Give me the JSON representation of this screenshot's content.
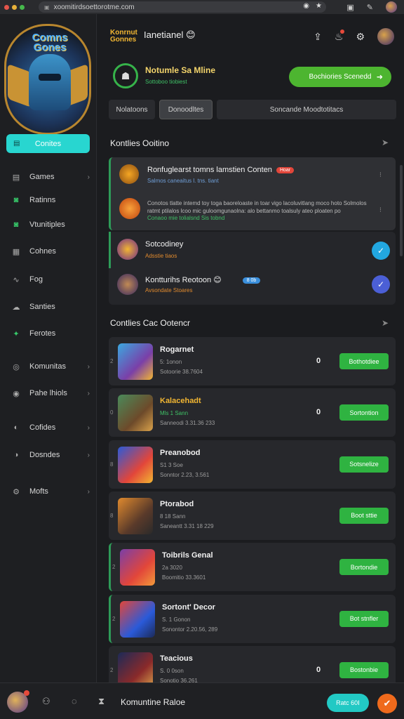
{
  "browser": {
    "url": "xoomitirdsoettorotme.com"
  },
  "sidebar": {
    "logo_text": "Comns Gones",
    "primary_button": "Conites",
    "items": [
      {
        "label": "Games",
        "icon": "gamepad-icon",
        "glyph": "▤",
        "chevron": true
      },
      {
        "label": "Ratinns",
        "icon": "discord-icon",
        "glyph": "◙",
        "chevron": false
      },
      {
        "label": "Vtunitiples",
        "icon": "discord-icon",
        "glyph": "◙",
        "chevron": false
      },
      {
        "label": "Cohnes",
        "icon": "grid-icon",
        "glyph": "▦",
        "chevron": false
      },
      {
        "label": "Fog",
        "icon": "chart-icon",
        "glyph": "∿",
        "chevron": false
      },
      {
        "label": "Santies",
        "icon": "cloud-icon",
        "glyph": "☁",
        "chevron": false
      },
      {
        "label": "Ferotes",
        "icon": "puzzle-icon",
        "glyph": "✦",
        "chevron": false
      },
      {
        "label": "Komunitas",
        "icon": "community-icon",
        "glyph": "◎",
        "chevron": true
      },
      {
        "label": "Pahe lhiols",
        "icon": "trophy-icon",
        "glyph": "◉",
        "chevron": true
      },
      {
        "label": "Cofides",
        "icon": "globe-icon",
        "glyph": "◐",
        "chevron": true
      },
      {
        "label": "Dosndes",
        "icon": "compass-icon",
        "glyph": "◑",
        "chevron": true
      },
      {
        "label": "Mofts",
        "icon": "gear-icon",
        "glyph": "⚙",
        "chevron": true
      }
    ]
  },
  "header": {
    "brand": "Konrnut Gonnes",
    "title": "Ianetianel 😊"
  },
  "profile": {
    "name": "Notumle Sa Mline",
    "subtitle": "Sottoboo tiobiest",
    "cta": "Bochiories Scenedd"
  },
  "tabs": [
    "Nolatoons",
    "Donoodltes",
    "Soncande Moodtotitacs"
  ],
  "notifications": {
    "title": "Kontlies Ooitino",
    "items": [
      {
        "title": "Ronfuglearst tomns lamstien Conten",
        "badge": "Hoar",
        "sub": "Salmos caneaitus l. tns. tiant",
        "sub_color": "#6f9ed6"
      },
      {
        "title": "",
        "body": "Conotos tlatte intemd toy toga baoreloaste in toar vigo lacoluvitlang moco hoto Solmolos ratmt ptilalos lcoo mic guloomgunaolna: alo bettanmo toalsuly ateo ploaten po gooptooodo ooonomoolo.",
        "sub": "Conaoo mie tolialsnd Sis tobnd",
        "sub_color": "#3fc166"
      },
      {
        "title": "Sotcodiney",
        "sub": "Adsstie tiaos",
        "sub_color": "#e08a2e"
      },
      {
        "title": "Kontturihs Reotoon 😊",
        "tag": "8 0b",
        "sub": "Avsondate Stoares",
        "sub_color": "#e08a2e"
      }
    ]
  },
  "games": {
    "title": "Contlies Cac Ootencr",
    "items": [
      {
        "rank": "2",
        "name": "Rogarnet",
        "meta1": "5: 1onon",
        "meta2": "Sotoorie 38.7604",
        "count": "0",
        "button": "Bothotdiee",
        "name_color": "#f1f1f1"
      },
      {
        "rank": "0",
        "name": "Kalacehadt",
        "meta1": "Mls 1 Sann",
        "meta2": "Sanneodi 3.31.36 233",
        "count": "0",
        "button": "Sortontion",
        "name_color": "#f2b632"
      },
      {
        "rank": "8",
        "name": "Preanobod",
        "meta1": "S1 3 Soe",
        "meta2": "Sonntor 2.23, 3.561",
        "count": "",
        "button": "Sotsnelize",
        "name_color": "#f1f1f1"
      },
      {
        "rank": "8",
        "name": "Ptorabod",
        "meta1": "8 18 Sann",
        "meta2": "Saneantt 3.31 18 229",
        "count": "",
        "button": "Boot sttie",
        "name_color": "#f1f1f1"
      },
      {
        "rank": "2",
        "name": "Toibrils Genal",
        "meta1": "2a 3020",
        "meta2": "Boomitio 33.3601",
        "count": "",
        "button": "Bortondie",
        "name_color": "#f1f1f1"
      },
      {
        "rank": "2",
        "name": "Sortont' Decor",
        "meta1": "S. 1 Gonon",
        "meta2": "Sonontor 2.20.56, 289",
        "count": "",
        "button": "Bot stnfler",
        "name_color": "#f1f1f1"
      },
      {
        "rank": "2",
        "name": "Teacious",
        "meta1": "S. 0 0son",
        "meta2": "Sonotio 36.261",
        "count": "0",
        "button": "Bostonbie",
        "name_color": "#f1f1f1"
      }
    ]
  },
  "bottom": {
    "label": "Komuntine Raloe",
    "button": "Ratc 60Ⅰ"
  }
}
